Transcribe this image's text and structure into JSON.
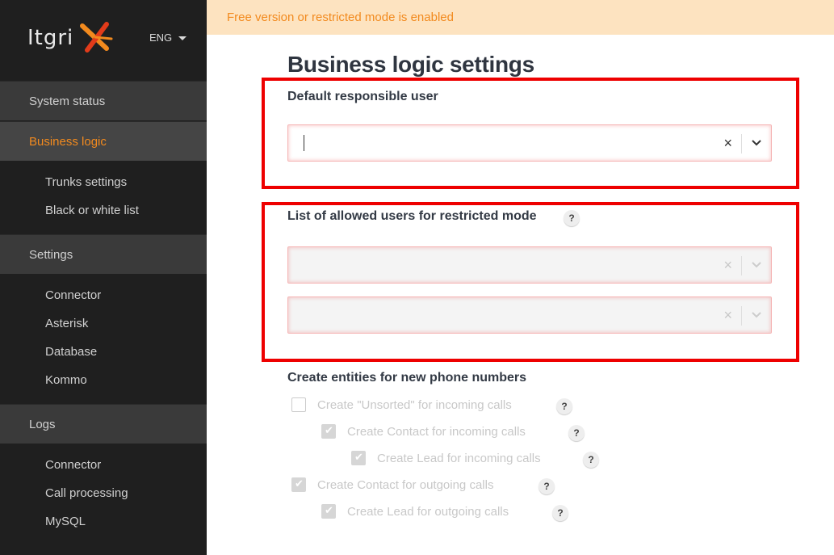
{
  "sidebar": {
    "brand": "Itgri",
    "lang": "ENG",
    "sections": [
      {
        "label": "System status"
      },
      {
        "label": "Business logic"
      },
      {
        "label": "Settings"
      },
      {
        "label": "Logs"
      }
    ],
    "business_sub": [
      "Trunks settings",
      "Black or white list"
    ],
    "settings_sub": [
      "Connector",
      "Asterisk",
      "Database",
      "Kommo"
    ],
    "logs_sub": [
      "Connector",
      "Call processing",
      "MySQL"
    ]
  },
  "banner": {
    "text": "Free version or restricted mode is enabled"
  },
  "page": {
    "title": "Business logic settings",
    "default_user_label": "Default responsible user",
    "allowed_users_label": "List of allowed users for restricted mode",
    "entities_label": "Create entities for new phone numbers",
    "help": "?",
    "clear": "×",
    "checkboxes": [
      {
        "label": "Create \"Unsorted\" for incoming calls",
        "checked": false
      },
      {
        "label": "Create Contact for incoming calls",
        "checked": true
      },
      {
        "label": "Create Lead for incoming calls",
        "checked": true
      },
      {
        "label": "Create Contact for outgoing calls",
        "checked": true
      },
      {
        "label": "Create Lead for outgoing calls",
        "checked": true
      }
    ]
  },
  "colors": {
    "accent": "#f28a1e",
    "highlight": "#ee0000",
    "banner_bg": "#fde3c0"
  }
}
